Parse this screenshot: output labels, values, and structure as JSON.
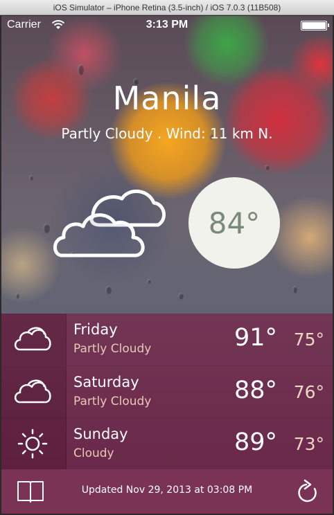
{
  "simulator": {
    "title": "iOS Simulator – iPhone Retina (3.5-inch) / iOS 7.0.3 (11B508)"
  },
  "status_bar": {
    "carrier": "Carrier",
    "time": "3:13 PM"
  },
  "current": {
    "city": "Manila",
    "summary": "Partly Cloudy . Wind: 11 km N.",
    "temperature": "84°",
    "icon": "partly-cloudy-icon"
  },
  "forecast": [
    {
      "day": "Friday",
      "condition": "Partly Cloudy",
      "high": "91°",
      "low": "75°",
      "icon": "cloud-icon"
    },
    {
      "day": "Saturday",
      "condition": "Partly Cloudy",
      "high": "88°",
      "low": "76°",
      "icon": "cloud-icon"
    },
    {
      "day": "Sunday",
      "condition": "Cloudy",
      "high": "89°",
      "low": "73°",
      "icon": "sun-icon"
    }
  ],
  "footer": {
    "updated": "Updated Nov 29, 2013 at 03:08 PM"
  },
  "colors": {
    "forecast_bg": "#7a2c52",
    "footer_bg": "#7a3355",
    "temp_circle_bg": "#f2f2ec",
    "temp_text": "#7a8a7a"
  }
}
